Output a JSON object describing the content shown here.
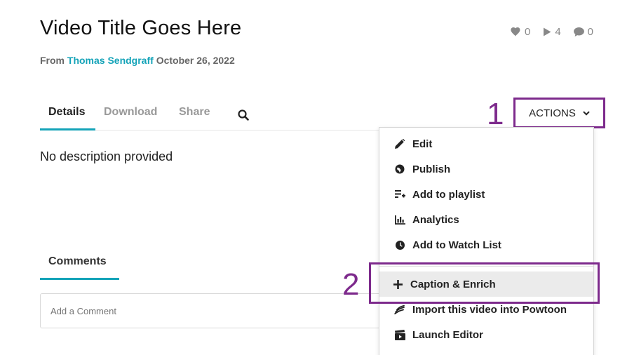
{
  "video": {
    "title": "Video Title Goes Here",
    "from_label": "From",
    "owner": "Thomas Sendgraff",
    "date": "October 26, 2022"
  },
  "stats": {
    "likes": "0",
    "plays": "4",
    "comments": "0"
  },
  "tabs": [
    {
      "label": "Details"
    },
    {
      "label": "Download"
    },
    {
      "label": "Share"
    }
  ],
  "actions": {
    "label": "ACTIONS"
  },
  "description": "No description provided",
  "comments": {
    "tab_label": "Comments",
    "placeholder": "Add a Comment"
  },
  "menu": {
    "items": [
      {
        "label": "Edit",
        "icon": "pencil-icon"
      },
      {
        "label": "Publish",
        "icon": "globe-icon"
      },
      {
        "label": "Add to playlist",
        "icon": "playlist-add-icon"
      },
      {
        "label": "Analytics",
        "icon": "bar-chart-icon"
      },
      {
        "label": "Add to Watch List",
        "icon": "clock-icon"
      },
      {
        "label": "Caption & Enrich",
        "icon": "plus-icon"
      },
      {
        "label": "Import this video into Powtoon",
        "icon": "powtoon-icon"
      },
      {
        "label": "Launch Editor",
        "icon": "clapperboard-icon"
      }
    ]
  },
  "annotations": {
    "step1": "1",
    "step2": "2",
    "color": "#7d2a8c"
  },
  "colors": {
    "accent": "#14a3b8"
  }
}
